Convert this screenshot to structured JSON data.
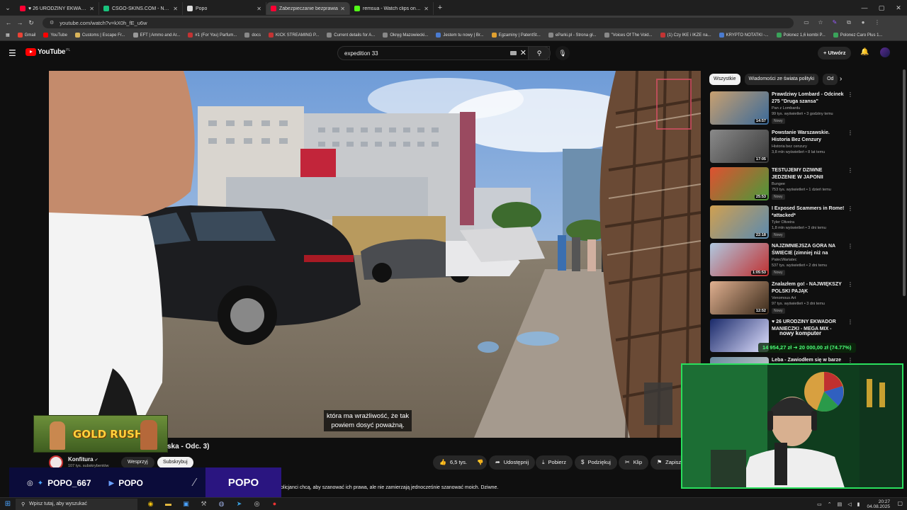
{
  "browser": {
    "tabs": [
      {
        "label": "♥ 26 URODZINY EKWADOR",
        "icon": "youtube-icon",
        "color": "#ff0033",
        "active": false
      },
      {
        "label": "CSGO-SKINS.COM - Najlepsze",
        "icon": "csgo-icon",
        "color": "#19c37d",
        "active": false
      },
      {
        "label": "Popo",
        "icon": "docs-icon",
        "color": "#dddddd",
        "active": false
      },
      {
        "label": "Zabezpieczanie bezprawia",
        "icon": "youtube-icon",
        "color": "#ff0033",
        "active": true
      },
      {
        "label": "remsua - Watch clips on Kick",
        "icon": "kick-icon",
        "color": "#53fc18",
        "active": false
      }
    ],
    "url": "youtube.com/watch?v=kX0h_fE_u6w",
    "bookmarks": [
      {
        "label": "Gmail",
        "color": "#ea4335"
      },
      {
        "label": "YouTube",
        "color": "#ff0000"
      },
      {
        "label": "Customs | Escape Fr...",
        "color": "#d9b45a"
      },
      {
        "label": "EFT | Ammo and Ar...",
        "color": "#999999"
      },
      {
        "label": "#1 (For You) Parfum...",
        "color": "#c33333"
      },
      {
        "label": "docs",
        "color": "#888888"
      },
      {
        "label": "KICK STREAMING P...",
        "color": "#c33333"
      },
      {
        "label": "Current details for A...",
        "color": "#888888"
      },
      {
        "label": "Okręg Mazowiecki...",
        "color": "#888888"
      },
      {
        "label": "Jestem tu nowy | Br...",
        "color": "#4a7bd0"
      },
      {
        "label": "Egzaminy | PatentSt...",
        "color": "#e0a030"
      },
      {
        "label": "eParki.pl - Strona gł...",
        "color": "#888888"
      },
      {
        "label": "\"Voices Of The Void...",
        "color": "#888888"
      },
      {
        "label": "(1) Czy IKE i IKZE na...",
        "color": "#c33333"
      },
      {
        "label": "KRYPTO NOTATKI -...",
        "color": "#4a7bd0"
      },
      {
        "label": "Polonez 1,6 kombi P...",
        "color": "#3aa35a"
      },
      {
        "label": "Polonez Caro Plus 1...",
        "color": "#3aa35a"
      }
    ]
  },
  "youtube": {
    "logo": "YouTube",
    "country": "PL",
    "search_query": "expedition 33",
    "create_label": "Utwórz",
    "video": {
      "subtitle_line1": "która ma wrażliwość, że tak",
      "subtitle_line2": "powiem dosyć poważną.",
      "title_visible": "ska - Odc. 3)",
      "channel": "Konfitura",
      "subs": "107 tys. subskrybentów",
      "support_label": "Wesprzyj",
      "subscribe_label": "Subskrybuj",
      "likes": "6,5 tys.",
      "share_label": "Udostępnij",
      "download_label": "Pobierz",
      "thanks_label": "Podziękuj",
      "clip_label": "Klip",
      "save_label": "Zapisz",
      "description": "olicjanci chcą, aby szanować ich prawa, ale nie zamierzają jednocześnie szanować moich. Dziwne."
    },
    "chips": [
      "Wszystkie",
      "Wiadomości ze świata polityki",
      "Od"
    ],
    "recommendations": [
      {
        "title": "Prawdziwy Lombard - Odcinek 275 \"Druga szansa\"",
        "channel": "Pan z Lombardu",
        "meta": "99 tys. wyświetleń • 3 godziny temu",
        "badge": "Nowy",
        "duration": "14:57",
        "c1": "#c8a070",
        "c2": "#3a6a9a"
      },
      {
        "title": "Powstanie  Warszawskie. Historia Bez Cenzury",
        "channel": "Historia bez cenzury",
        "meta": "3,8 mln wyświetleń • 8 lat temu",
        "badge": "",
        "duration": "17:05",
        "c1": "#8a8a8a",
        "c2": "#3a3a3a"
      },
      {
        "title": "TESTUJEMY DZIWNE JEDZENIE W JAPONII",
        "channel": "Bungee",
        "meta": "753 tys. wyświetleń • 1 dzień temu",
        "badge": "Nowy",
        "duration": "25:53",
        "c1": "#e05030",
        "c2": "#4a9a3a"
      },
      {
        "title": "I Exposed Scammers in Rome! *attacked*",
        "channel": "Tyler Oliveira",
        "meta": "1,8 mln wyświetleń • 3 dni temu",
        "badge": "Nowy",
        "duration": "22:18",
        "c1": "#d0a050",
        "c2": "#5a8ab0"
      },
      {
        "title": "NAJZIMNIEJSZA GÓRA NA ŚWIECIE (zimniej niż na Mount...",
        "channel": "PatecWariatec",
        "meta": "537 tys. wyświetleń • 2 dni temu",
        "badge": "Nowy",
        "duration": "1:05:53",
        "c1": "#b0c8e0",
        "c2": "#c03030"
      },
      {
        "title": "Znalazłem go! - NAJWIĘKSZY POLSKI PAJĄK",
        "channel": "Venomous Art",
        "meta": "97 tys. wyświetleń • 3 dni temu",
        "badge": "Nowy",
        "duration": "12:52",
        "c1": "#e0b090",
        "c2": "#3a2a1a"
      },
      {
        "title": "♥ 26 URODZINY EKWADOR MANIECZKI - MEGA MIX -",
        "channel": "",
        "meta": "",
        "badge": "",
        "duration": "",
        "c1": "#1a2a6a",
        "c2": "#e0e0ff"
      },
      {
        "title": "Leba - Zawiodłem się w barze",
        "channel": "",
        "meta": "",
        "badge": "",
        "duration": "",
        "c1": "#6a8aa0",
        "c2": "#d0d0d0"
      }
    ],
    "donation_title": "nowy komputer",
    "donation_amount": "14 954,27 zł ➜ 20 000,00 zł (74.77%)"
  },
  "overlay": {
    "game_banner": "GOLD RUSH",
    "social_handle": "POPO_667",
    "youtube_handle": "POPO",
    "kick_name": "POPO"
  },
  "taskbar": {
    "search_placeholder": "Wpisz tutaj, aby wyszukać",
    "time": "20:27",
    "date": "04.08.2025"
  }
}
